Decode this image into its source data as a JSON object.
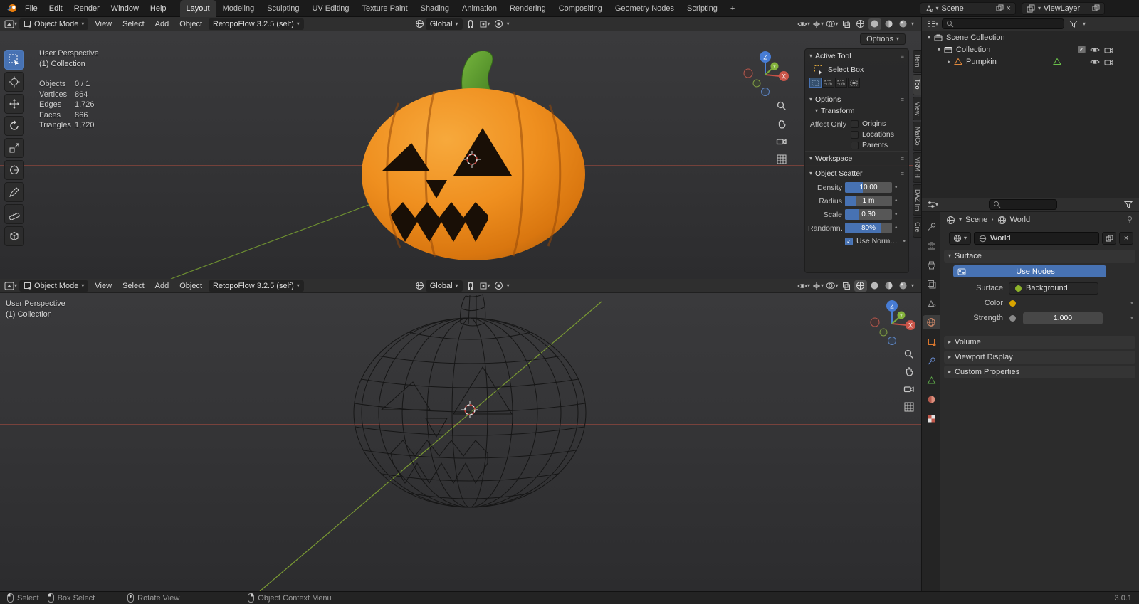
{
  "icons": {
    "chevron_down": "▾",
    "chevron_right": "▸",
    "panel_menu": "≡",
    "dot": "•",
    "close": "×",
    "check": "✓",
    "breadcrumb_sep": "›"
  },
  "topbar": {
    "menus": [
      "File",
      "Edit",
      "Render",
      "Window",
      "Help"
    ],
    "tabs": [
      "Layout",
      "Modeling",
      "Sculpting",
      "UV Editing",
      "Texture Paint",
      "Shading",
      "Animation",
      "Rendering",
      "Compositing",
      "Geometry Nodes",
      "Scripting"
    ],
    "add_tab": "+",
    "scene": "Scene",
    "view_layer": "ViewLayer"
  },
  "viewport": {
    "mode": "Object Mode",
    "menus": [
      "View",
      "Select",
      "Add",
      "Object"
    ],
    "addon": "RetopoFlow 3.2.5 (self)",
    "orientation": "Global",
    "options_button": "Options"
  },
  "overlay_top": {
    "view_label": "User Perspective",
    "collection_label": "(1) Collection",
    "stats": [
      {
        "label": "Objects",
        "value": "0 / 1"
      },
      {
        "label": "Vertices",
        "value": "864"
      },
      {
        "label": "Edges",
        "value": "1,726"
      },
      {
        "label": "Faces",
        "value": "866"
      },
      {
        "label": "Triangles",
        "value": "1,720"
      }
    ]
  },
  "overlay_bottom": {
    "view_label": "User Perspective",
    "collection_label": "(1) Collection"
  },
  "npanel": {
    "tabs": [
      "Item",
      "Tool",
      "View",
      "MatCo",
      "VRM H",
      "DAZ Im",
      "Cre"
    ],
    "active_tool_title": "Active Tool",
    "tool_name": "Select Box",
    "options_title": "Options",
    "transform_title": "Transform",
    "affect_only_label": "Affect Only",
    "affect_options": [
      "Origins",
      "Locations",
      "Parents"
    ],
    "workspace_title": "Workspace",
    "scatter_title": "Object Scatter",
    "scatter_rows": [
      {
        "label": "Density",
        "value": "10.00",
        "fill": 38
      },
      {
        "label": "Radius",
        "value": "1 m",
        "fill": 22
      },
      {
        "label": "Scale",
        "value": "0.30",
        "fill": 30
      },
      {
        "label": "Randomn…",
        "value": "80%",
        "fill": 78
      }
    ],
    "use_normals_label": "Use Norm…"
  },
  "outliner": {
    "rows": [
      {
        "label": "Scene Collection"
      },
      {
        "label": "Collection"
      },
      {
        "label": "Pumpkin"
      }
    ]
  },
  "properties": {
    "breadcrumb_scene": "Scene",
    "breadcrumb_world": "World",
    "world_name": "World",
    "use_nodes": "Use Nodes",
    "surface_section": "Surface",
    "surface_label": "Surface",
    "surface_value": "Background",
    "color_label": "Color",
    "strength_label": "Strength",
    "strength_value": "1.000",
    "collapsed": [
      "Volume",
      "Viewport Display",
      "Custom Properties"
    ]
  },
  "statusbar": {
    "hints": [
      "Select",
      "Box Select",
      "Rotate View",
      "Object Context Menu"
    ],
    "version": "3.0.1"
  },
  "colors": {
    "accent": "#4772b3",
    "pumpkin": "#ef8f1f",
    "stem": "#5a9e32"
  }
}
